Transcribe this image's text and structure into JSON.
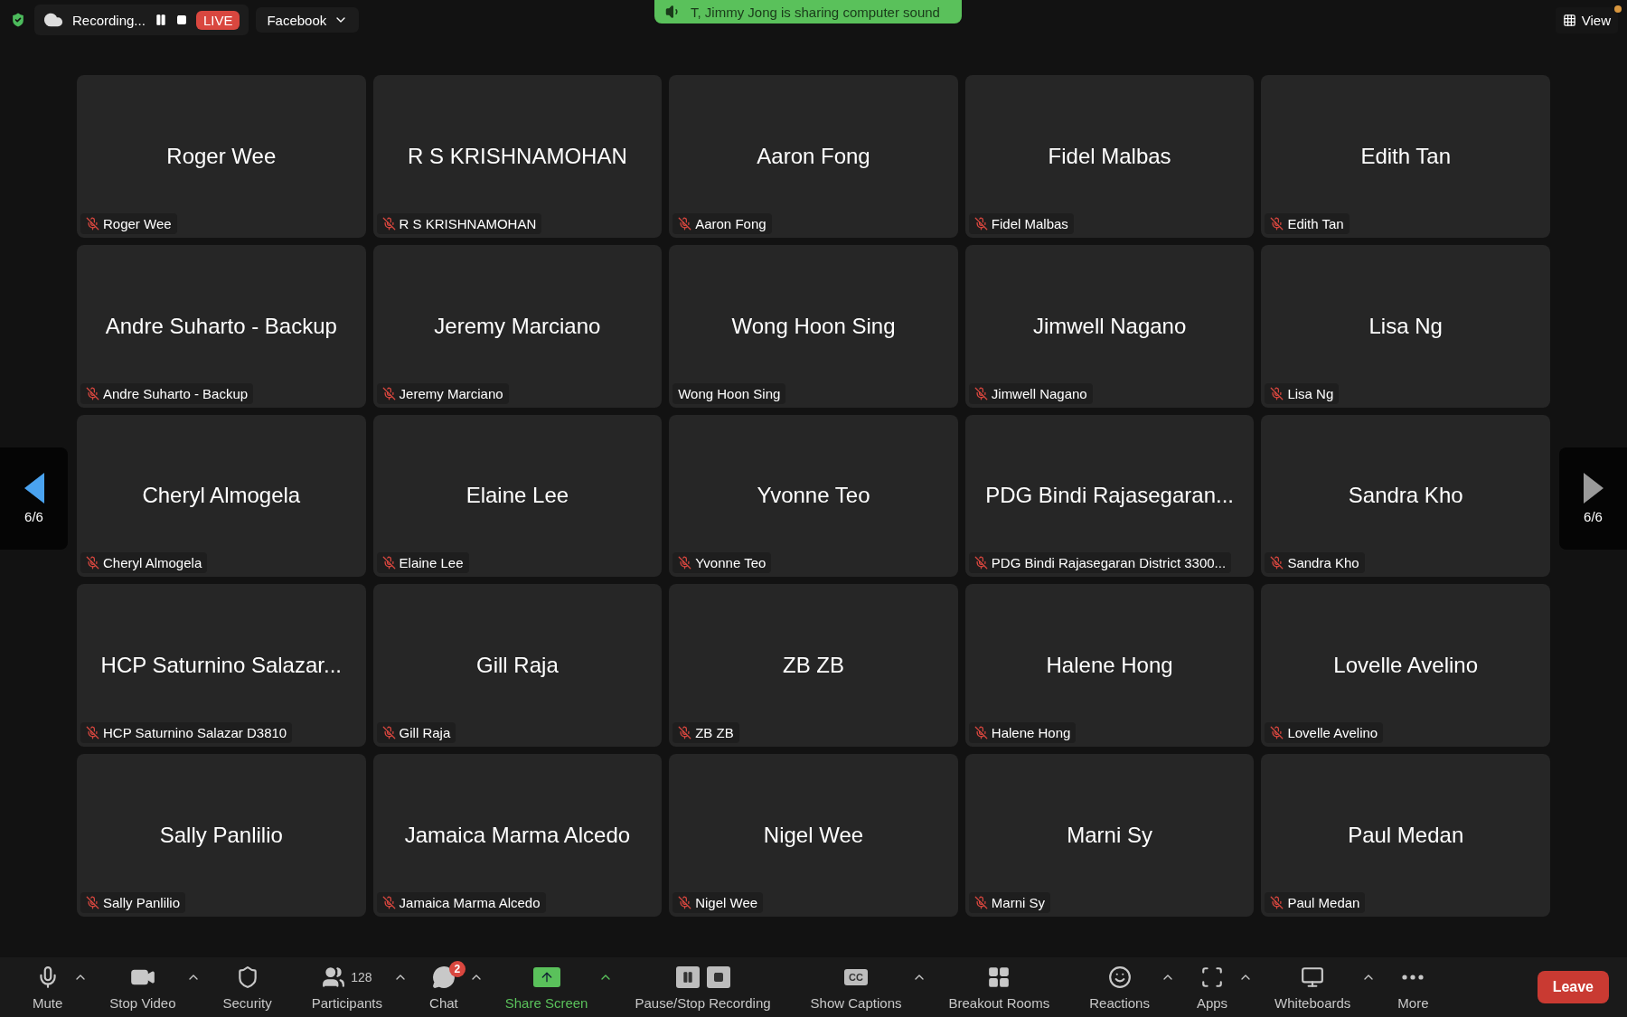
{
  "top_bar": {
    "recording": {
      "label": "Recording...",
      "live": "LIVE",
      "destination": "Facebook"
    },
    "sharing_banner": "T, Jimmy Jong is sharing computer sound",
    "view_button": "View"
  },
  "pager": {
    "previous": {
      "page": "6/6",
      "disabled": false
    },
    "next": {
      "page": "6/6",
      "disabled": true
    }
  },
  "tiles": [
    {
      "display_name": "Roger Wee",
      "label": "Roger Wee",
      "muted": true
    },
    {
      "display_name": "R S KRISHNAMOHAN",
      "label": "R S KRISHNAMOHAN",
      "muted": true
    },
    {
      "display_name": "Aaron Fong",
      "label": "Aaron Fong",
      "muted": true
    },
    {
      "display_name": "Fidel Malbas",
      "label": "Fidel Malbas",
      "muted": true
    },
    {
      "display_name": "Edith Tan",
      "label": "Edith Tan",
      "muted": true
    },
    {
      "display_name": "Andre Suharto - Backup",
      "label": "Andre Suharto - Backup",
      "muted": true
    },
    {
      "display_name": "Jeremy Marciano",
      "label": "Jeremy Marciano",
      "muted": true
    },
    {
      "display_name": "Wong Hoon Sing",
      "label": "Wong Hoon Sing",
      "muted": false
    },
    {
      "display_name": "Jimwell Nagano",
      "label": "Jimwell Nagano",
      "muted": true
    },
    {
      "display_name": "Lisa Ng",
      "label": "Lisa Ng",
      "muted": true
    },
    {
      "display_name": "Cheryl Almogela",
      "label": "Cheryl Almogela",
      "muted": true
    },
    {
      "display_name": "Elaine Lee",
      "label": "Elaine Lee",
      "muted": true
    },
    {
      "display_name": "Yvonne Teo",
      "label": "Yvonne Teo",
      "muted": true
    },
    {
      "display_name": "PDG Bindi Rajasegaran...",
      "label": "PDG Bindi Rajasegaran District 3300...",
      "muted": true
    },
    {
      "display_name": "Sandra Kho",
      "label": "Sandra Kho",
      "muted": true
    },
    {
      "display_name": "HCP Saturnino Salazar...",
      "label": "HCP Saturnino Salazar  D3810",
      "muted": true
    },
    {
      "display_name": "Gill Raja",
      "label": "Gill Raja",
      "muted": true
    },
    {
      "display_name": "ZB ZB",
      "label": "ZB ZB",
      "muted": true
    },
    {
      "display_name": "Halene Hong",
      "label": "Halene Hong",
      "muted": true
    },
    {
      "display_name": "Lovelle Avelino",
      "label": "Lovelle Avelino",
      "muted": true
    },
    {
      "display_name": "Sally Panlilio",
      "label": "Sally Panlilio",
      "muted": true
    },
    {
      "display_name": "Jamaica Marma Alcedo",
      "label": "Jamaica Marma Alcedo",
      "muted": true
    },
    {
      "display_name": "Nigel Wee",
      "label": "Nigel Wee",
      "muted": true
    },
    {
      "display_name": "Marni Sy",
      "label": "Marni Sy",
      "muted": true
    },
    {
      "display_name": "Paul Medan",
      "label": "Paul Medan",
      "muted": true
    }
  ],
  "toolbar": {
    "items": [
      {
        "kind": "mic",
        "label": "Mute",
        "has_menu": true,
        "active": false
      },
      {
        "kind": "video",
        "label": "Stop Video",
        "has_menu": true,
        "active": false
      },
      {
        "kind": "security",
        "label": "Security",
        "has_menu": false,
        "active": false
      },
      {
        "kind": "participants",
        "label": "Participants",
        "count": "128",
        "has_menu": true,
        "active": false
      },
      {
        "kind": "chat",
        "label": "Chat",
        "badge": "2",
        "has_menu": true,
        "active": false
      },
      {
        "kind": "share",
        "label": "Share Screen",
        "has_menu": true,
        "active": true
      },
      {
        "kind": "recording",
        "label": "Pause/Stop Recording",
        "has_menu": false,
        "active": false
      },
      {
        "kind": "captions",
        "label": "Show Captions",
        "icon_text": "CC",
        "has_menu": true,
        "active": false
      },
      {
        "kind": "breakout",
        "label": "Breakout Rooms",
        "has_menu": false,
        "active": false
      },
      {
        "kind": "reactions",
        "label": "Reactions",
        "has_menu": true,
        "active": false
      },
      {
        "kind": "apps",
        "label": "Apps",
        "has_menu": true,
        "active": false
      },
      {
        "kind": "whiteboards",
        "label": "Whiteboards",
        "has_menu": true,
        "active": false
      },
      {
        "kind": "more",
        "label": "More",
        "has_menu": false,
        "active": false
      }
    ],
    "leave": "Leave"
  }
}
